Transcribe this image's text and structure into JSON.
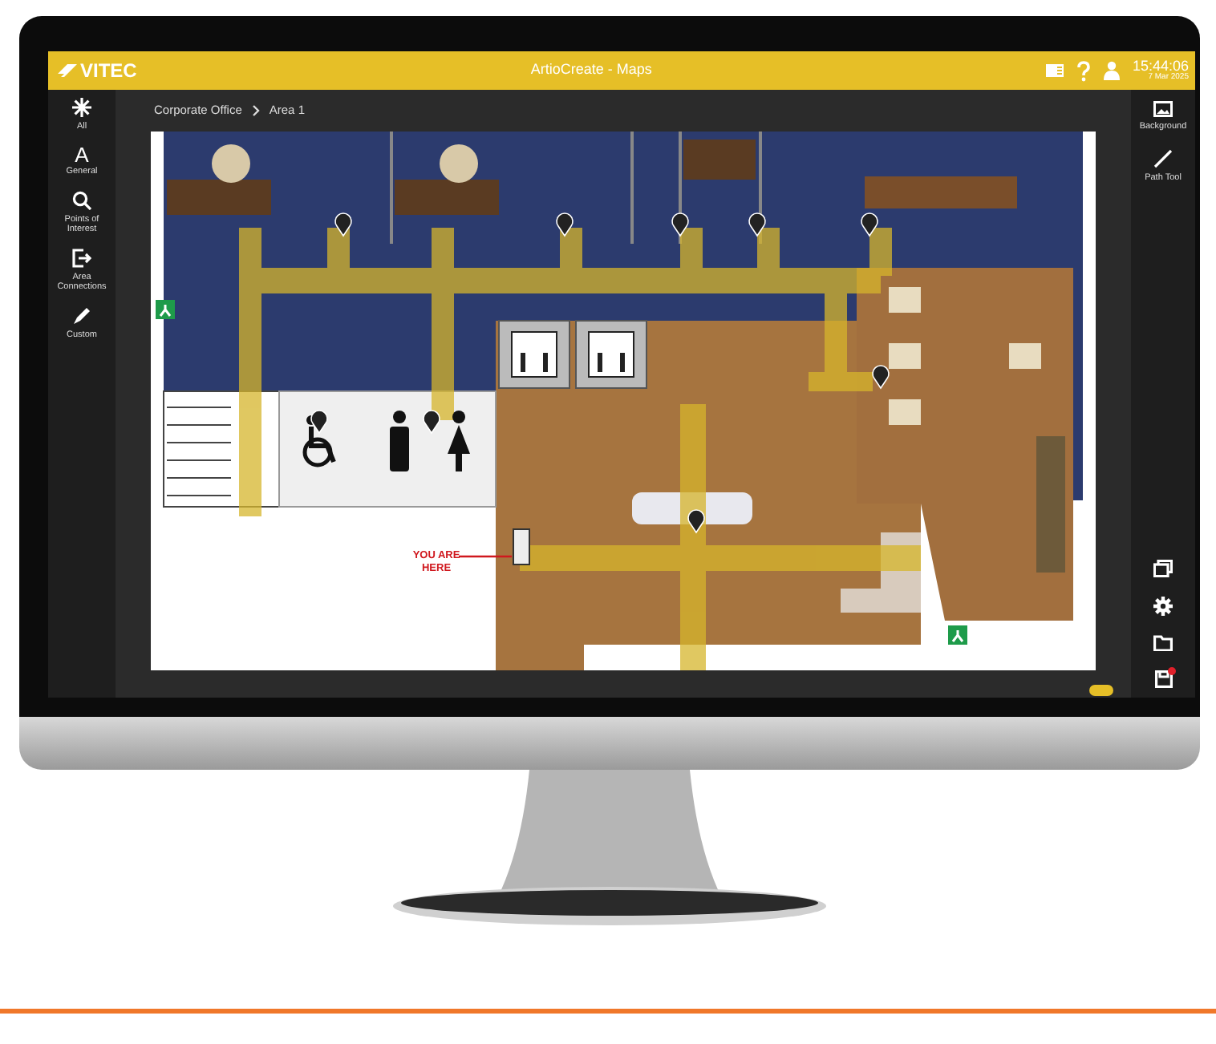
{
  "app_bar": {
    "logo": "VITEC",
    "title": "ArtioCreate - Maps",
    "time": "15:44:06",
    "date": "7 Mar 2025"
  },
  "left_tools": [
    {
      "kind": "all",
      "label": "All"
    },
    {
      "kind": "general",
      "glyph": "A",
      "label": "General"
    },
    {
      "kind": "poi",
      "label": "Points of Interest"
    },
    {
      "kind": "connections",
      "label": "Area Connections"
    },
    {
      "kind": "custom",
      "label": "Custom"
    }
  ],
  "breadcrumb": [
    "Corporate Office",
    "Area 1"
  ],
  "map": {
    "marker_label": [
      "YOU ARE",
      "HERE"
    ]
  },
  "right_tools": [
    {
      "kind": "background",
      "label": "Background"
    },
    {
      "kind": "path",
      "label": "Path Tool"
    }
  ],
  "bottom_tools": [
    {
      "kind": "layers",
      "alert": false
    },
    {
      "kind": "settings",
      "alert": false
    },
    {
      "kind": "folder",
      "alert": false
    },
    {
      "kind": "save",
      "alert": true
    }
  ]
}
